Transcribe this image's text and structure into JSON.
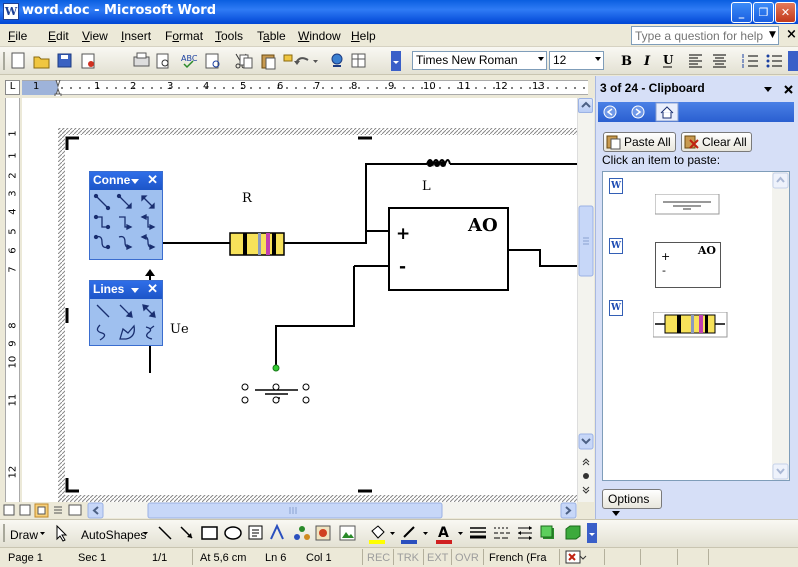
{
  "window": {
    "title": "word.doc - Microsoft Word",
    "app_icon": "W",
    "controls": {
      "minimize": "_",
      "maximize": "❐",
      "close": "✕"
    }
  },
  "menu": {
    "items": [
      {
        "label": "File",
        "accel": "F"
      },
      {
        "label": "Edit",
        "accel": "E"
      },
      {
        "label": "View",
        "accel": "V"
      },
      {
        "label": "Insert",
        "accel": "I"
      },
      {
        "label": "Format",
        "accel": "o"
      },
      {
        "label": "Tools",
        "accel": "T"
      },
      {
        "label": "Table",
        "accel": "a"
      },
      {
        "label": "Window",
        "accel": "W"
      },
      {
        "label": "Help",
        "accel": "H"
      }
    ],
    "help_placeholder": "Type a question for help",
    "doc_close": "×"
  },
  "toolbar": {
    "font_name": "Times New Roman",
    "font_size": "12"
  },
  "ruler": {
    "tab_selector": "L",
    "numbers": [
      "1",
      "1",
      "2",
      "3",
      "4",
      "5",
      "6",
      "7",
      "8",
      "9",
      "10",
      "11",
      "12",
      "13"
    ],
    "vertical_numbers": [
      "1",
      "1",
      "2",
      "3",
      "4",
      "5",
      "6",
      "7",
      "8",
      "9",
      "10",
      "11",
      "12"
    ]
  },
  "document": {
    "labels": {
      "resistor": "R",
      "inductor": "L",
      "opamp": "AO",
      "plus": "+",
      "minus": "-",
      "voltage": "Ue"
    }
  },
  "connectors_toolbar": {
    "title": "Conne"
  },
  "lines_toolbar": {
    "title": "Lines"
  },
  "task_pane": {
    "header": "3 of 24 - Clipboard",
    "paste_all": "Paste All",
    "clear_all": "Clear All",
    "hint": "Click an item to paste:",
    "item_icon": "W",
    "options": "Options",
    "preview_ao": "AO",
    "preview_plus": "+",
    "preview_minus": "-"
  },
  "draw_toolbar": {
    "draw_label": "Draw",
    "autoshapes_label": "AutoShapes"
  },
  "status": {
    "page": "Page 1",
    "sec": "Sec 1",
    "pages": "1/1",
    "at": "At 5,6 cm",
    "ln": "Ln 6",
    "col": "Col 1",
    "rec": "REC",
    "trk": "TRK",
    "ext": "EXT",
    "ovr": "OVR",
    "language": "French (Fra"
  }
}
